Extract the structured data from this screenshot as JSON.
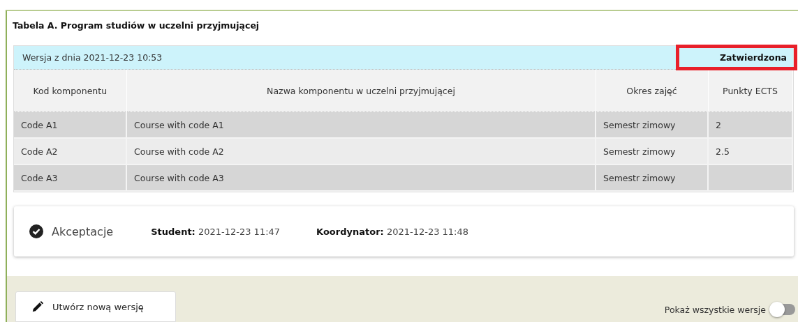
{
  "panel": {
    "title": "Tabela A. Program studiów w uczelni przyjmującej"
  },
  "version": {
    "label": "Wersja z dnia 2021-12-23 10:53",
    "status": "Zatwierdzona",
    "highlighted": true
  },
  "table": {
    "columns": [
      "Kod komponentu",
      "Nazwa komponentu w uczelni przyjmującej",
      "Okres zajęć",
      "Punkty ECTS"
    ],
    "rows": [
      {
        "code": "Code A1",
        "name": "Course with code A1",
        "period": "Semestr zimowy",
        "ects": "2"
      },
      {
        "code": "Code A2",
        "name": "Course with code A2",
        "period": "Semestr zimowy",
        "ects": "2.5"
      },
      {
        "code": "Code A3",
        "name": "Course with code A3",
        "period": "Semestr zimowy"
      }
    ]
  },
  "acceptance": {
    "title": "Akceptacje",
    "checked": true,
    "entries": [
      {
        "label": "Student:",
        "value": "2021-12-23 11:47"
      },
      {
        "label": "Koordynator:",
        "value": "2021-12-23 11:48"
      }
    ]
  },
  "footer": {
    "button": "Utwórz nową wersję",
    "toggle": {
      "label": "Pokaż wszystkie wersje",
      "on": false
    }
  }
}
